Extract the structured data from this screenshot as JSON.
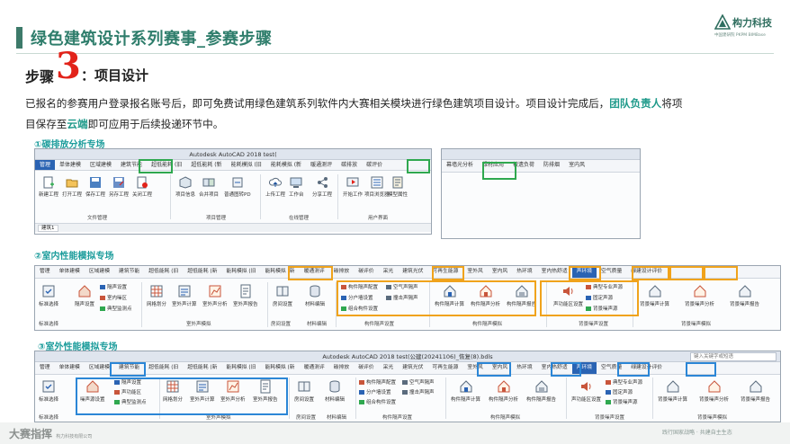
{
  "header": {
    "title": "绿色建筑设计系列赛事_参赛步骤",
    "logo_name": "构力科技",
    "logo_sub": "中国建研院 PKPM BIMBase"
  },
  "step": {
    "label": "步骤",
    "number": "3",
    "title": "：项目设计"
  },
  "paragraph": {
    "line1_a": "已报名的参赛用户登录报名账号后，即可免费试用绿色建筑系列软件内大赛相关模块进行绿色建筑项目设计。项目设计完成后，",
    "line1_hl": "团队负责人",
    "line1_b": "将项",
    "line2_a": "目保存至",
    "line2_hl": "云端",
    "line2_b": "即可应用于后续投递环节中。"
  },
  "sections": {
    "carbon": "①碳排放分析专场",
    "indoor": "②室内性能模拟专场",
    "outdoor": "③室外性能模拟专场"
  },
  "shot1": {
    "title": "Autodesk AutoCAD 2018  test(",
    "tabs": [
      "管理",
      "单体建模",
      "区域建模",
      "建筑节能",
      "超低能耗 (旧",
      "超低能耗 (新",
      "能耗模拟 (旧",
      "能耗模拟 (新",
      "暖通测评",
      "碳排放",
      "碳评价"
    ],
    "buttons": [
      "新建工程",
      "打开工程",
      "保存工程",
      "另存工程",
      "关闭工程",
      "项目信息",
      "合并项目",
      "普通图转PD",
      "上传工程",
      "工作台",
      "分享工程",
      "开始工作",
      "项目浏览器",
      "模型属性"
    ],
    "groups": [
      "文件管理",
      "项目管理",
      "在线管理",
      "用户界面"
    ],
    "status": "建筑1"
  },
  "shot1b": {
    "tabs": [
      "幕墙光分析",
      "绿材应用",
      "被遗负荷",
      "防排烟",
      "室内风"
    ]
  },
  "shot2": {
    "tabs": [
      "管理",
      "单体建模",
      "区域建模",
      "建筑节能",
      "超低能耗 (旧",
      "超低能耗 (新",
      "能耗模拟 (旧",
      "能耗模拟 (新",
      "暖通测评",
      "碳排放",
      "碳评价",
      "采光",
      "建筑光伏",
      "可再生能源",
      "室外风",
      "室内风",
      "热环境",
      "室内热舒适",
      "声环境",
      "空气质量",
      "绿建设计评价"
    ],
    "buttons": [
      "标准选择",
      "隔声设置",
      "室内声设置",
      "分户墙设置",
      "房间设置",
      "材料编辑",
      "网格划分",
      "室外声计算",
      "室外声分析",
      "室外声报告",
      "构件隔声计算",
      "构件隔声分析",
      "构件隔声报告",
      "声功能区设置",
      "背景噪声计算",
      "背景噪声分析",
      "背景噪声报告"
    ],
    "small": [
      "隔声设置",
      "室内噪区",
      "典型监测点",
      "构件隔声配置",
      "分户墙设置",
      "组合构件设置",
      "空气声隔声",
      "撞击声隔声",
      "典型专业声源",
      "固定声源",
      "背景噪声源"
    ],
    "groups": [
      "标准选择",
      "室外声模拟",
      "房间设置",
      "材料编辑",
      "构件隔声设置",
      "构件隔声模拟",
      "背景噪声设置",
      "背景噪声模拟"
    ]
  },
  "shot3": {
    "title": "Autodesk AutoCAD 2018  test(公建(20241106)_恢复(8).bdls",
    "search": "键入关键字或短语",
    "tabs": [
      "管理",
      "单体建模",
      "区域建模",
      "建筑节能",
      "超低能耗 (旧",
      "超低能耗 (新",
      "能耗模拟 (旧",
      "能耗模拟 (新",
      "暖通测评",
      "碳排放",
      "碳评价",
      "采光",
      "建筑光伏",
      "可再生能源",
      "室外风",
      "室内风",
      "热环境",
      "室内热舒适",
      "声环境",
      "空气质量",
      "绿建设计评价"
    ],
    "buttons": [
      "标准选择",
      "噪声源设置",
      "网格划分",
      "室外声计算",
      "室外声分析",
      "室外声报告",
      "房间设置",
      "材料编辑",
      "构件隔声计算",
      "构件隔声分析",
      "构件隔声报告",
      "声功能区设置",
      "背景噪声计算",
      "背景噪声分析",
      "背景噪声报告"
    ],
    "small": [
      "隔声设置",
      "声功能区",
      "典型监测点",
      "构件隔声配置",
      "分户墙设置",
      "组合构件设置",
      "空气声隔声",
      "撞击声隔声",
      "典型专业声源",
      "固定声源",
      "背景噪声源"
    ],
    "groups": [
      "标准选择",
      "室外声模拟",
      "房间设置",
      "材料编辑",
      "构件隔声设置",
      "构件隔声模拟",
      "背景噪声设置",
      "背景噪声模拟"
    ]
  },
  "footer": {
    "left": "大赛指挥",
    "left_sub": "构力科技有限公司",
    "right": "践行国家战略 · 共建自主生态"
  }
}
